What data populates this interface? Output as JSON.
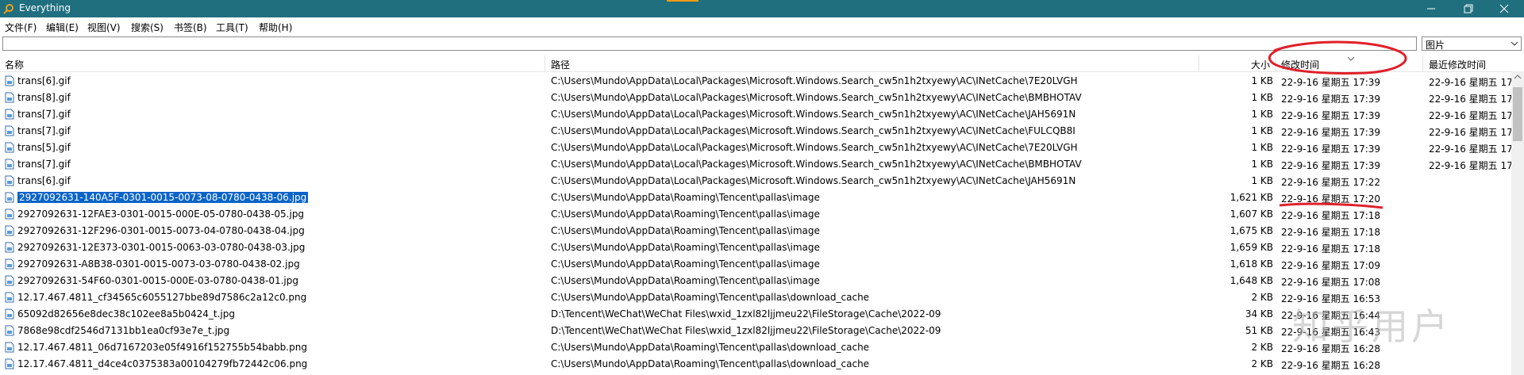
{
  "window": {
    "title": "Everything",
    "accent": "#1f6f7f"
  },
  "menu": [
    "文件(F)",
    "编辑(E)",
    "视图(V)",
    "搜索(S)",
    "书签(B)",
    "工具(T)",
    "帮助(H)"
  ],
  "search": {
    "value": "",
    "filter": "图片"
  },
  "columns": {
    "name": "名称",
    "path": "路径",
    "size": "大小",
    "modified": "修改时间",
    "recent": "最近修改时间"
  },
  "rows": [
    {
      "name": "trans[6].gif",
      "path": "C:\\Users\\Mundo\\AppData\\Local\\Packages\\Microsoft.Windows.Search_cw5n1h2txyewy\\AC\\INetCache\\7E20LVGH",
      "size": "1 KB",
      "modified": "22-9-16 星期五 17:39",
      "recent": "22-9-16 星期五 17"
    },
    {
      "name": "trans[8].gif",
      "path": "C:\\Users\\Mundo\\AppData\\Local\\Packages\\Microsoft.Windows.Search_cw5n1h2txyewy\\AC\\INetCache\\BMBHOTAV",
      "size": "1 KB",
      "modified": "22-9-16 星期五 17:39",
      "recent": "22-9-16 星期五 17"
    },
    {
      "name": "trans[7].gif",
      "path": "C:\\Users\\Mundo\\AppData\\Local\\Packages\\Microsoft.Windows.Search_cw5n1h2txyewy\\AC\\INetCache\\JAH5691N",
      "size": "1 KB",
      "modified": "22-9-16 星期五 17:39",
      "recent": "22-9-16 星期五 17"
    },
    {
      "name": "trans[7].gif",
      "path": "C:\\Users\\Mundo\\AppData\\Local\\Packages\\Microsoft.Windows.Search_cw5n1h2txyewy\\AC\\INetCache\\FULCQB8I",
      "size": "1 KB",
      "modified": "22-9-16 星期五 17:39",
      "recent": "22-9-16 星期五 17"
    },
    {
      "name": "trans[5].gif",
      "path": "C:\\Users\\Mundo\\AppData\\Local\\Packages\\Microsoft.Windows.Search_cw5n1h2txyewy\\AC\\INetCache\\7E20LVGH",
      "size": "1 KB",
      "modified": "22-9-16 星期五 17:39",
      "recent": "22-9-16 星期五 17"
    },
    {
      "name": "trans[7].gif",
      "path": "C:\\Users\\Mundo\\AppData\\Local\\Packages\\Microsoft.Windows.Search_cw5n1h2txyewy\\AC\\INetCache\\BMBHOTAV",
      "size": "1 KB",
      "modified": "22-9-16 星期五 17:39",
      "recent": "22-9-16 星期五 17"
    },
    {
      "name": "trans[6].gif",
      "path": "C:\\Users\\Mundo\\AppData\\Local\\Packages\\Microsoft.Windows.Search_cw5n1h2txyewy\\AC\\INetCache\\JAH5691N",
      "size": "1 KB",
      "modified": "22-9-16 星期五 17:22",
      "recent": ""
    },
    {
      "name": "2927092631-140A5F-0301-0015-0073-08-0780-0438-06.jpg",
      "path": "C:\\Users\\Mundo\\AppData\\Roaming\\Tencent\\pallas\\image",
      "size": "1,621 KB",
      "modified": "22-9-16 星期五 17:20",
      "recent": "",
      "selected": true
    },
    {
      "name": "2927092631-12FAE3-0301-0015-000E-05-0780-0438-05.jpg",
      "path": "C:\\Users\\Mundo\\AppData\\Roaming\\Tencent\\pallas\\image",
      "size": "1,607 KB",
      "modified": "22-9-16 星期五 17:18",
      "recent": ""
    },
    {
      "name": "2927092631-12F296-0301-0015-0073-04-0780-0438-04.jpg",
      "path": "C:\\Users\\Mundo\\AppData\\Roaming\\Tencent\\pallas\\image",
      "size": "1,675 KB",
      "modified": "22-9-16 星期五 17:18",
      "recent": ""
    },
    {
      "name": "2927092631-12E373-0301-0015-0063-03-0780-0438-03.jpg",
      "path": "C:\\Users\\Mundo\\AppData\\Roaming\\Tencent\\pallas\\image",
      "size": "1,659 KB",
      "modified": "22-9-16 星期五 17:18",
      "recent": ""
    },
    {
      "name": "2927092631-A8B38-0301-0015-0073-03-0780-0438-02.jpg",
      "path": "C:\\Users\\Mundo\\AppData\\Roaming\\Tencent\\pallas\\image",
      "size": "1,618 KB",
      "modified": "22-9-16 星期五 17:09",
      "recent": ""
    },
    {
      "name": "2927092631-54F60-0301-0015-000E-03-0780-0438-01.jpg",
      "path": "C:\\Users\\Mundo\\AppData\\Roaming\\Tencent\\pallas\\image",
      "size": "1,648 KB",
      "modified": "22-9-16 星期五 17:08",
      "recent": ""
    },
    {
      "name": "12.17.467.4811_cf34565c6055127bbe89d7586c2a12c0.png",
      "path": "C:\\Users\\Mundo\\AppData\\Roaming\\Tencent\\pallas\\download_cache",
      "size": "2 KB",
      "modified": "22-9-16 星期五 16:53",
      "recent": ""
    },
    {
      "name": "65092d82656e8dec38c102ee8a5b0424_t.jpg",
      "path": "D:\\Tencent\\WeChat\\WeChat Files\\wxid_1zxl82ljjmeu22\\FileStorage\\Cache\\2022-09",
      "size": "34 KB",
      "modified": "22-9-16 星期五 16:44",
      "recent": ""
    },
    {
      "name": "7868e98cdf2546d7131bb1ea0cf93e7e_t.jpg",
      "path": "D:\\Tencent\\WeChat\\WeChat Files\\wxid_1zxl82ljjmeu22\\FileStorage\\Cache\\2022-09",
      "size": "51 KB",
      "modified": "22-9-16 星期五 16:43",
      "recent": ""
    },
    {
      "name": "12.17.467.4811_06d7167203e05f4916f152755b54babb.png",
      "path": "C:\\Users\\Mundo\\AppData\\Roaming\\Tencent\\pallas\\download_cache",
      "size": "2 KB",
      "modified": "22-9-16 星期五 16:28",
      "recent": ""
    },
    {
      "name": "12.17.467.4811_d4ce4c0375383a00104279fb72442c06.png",
      "path": "C:\\Users\\Mundo\\AppData\\Roaming\\Tencent\\pallas\\download_cache",
      "size": "2 KB",
      "modified": "22-9-16 星期五 16:28",
      "recent": ""
    }
  ],
  "watermark": "知乎用户",
  "annotation_color": "#e0202a"
}
